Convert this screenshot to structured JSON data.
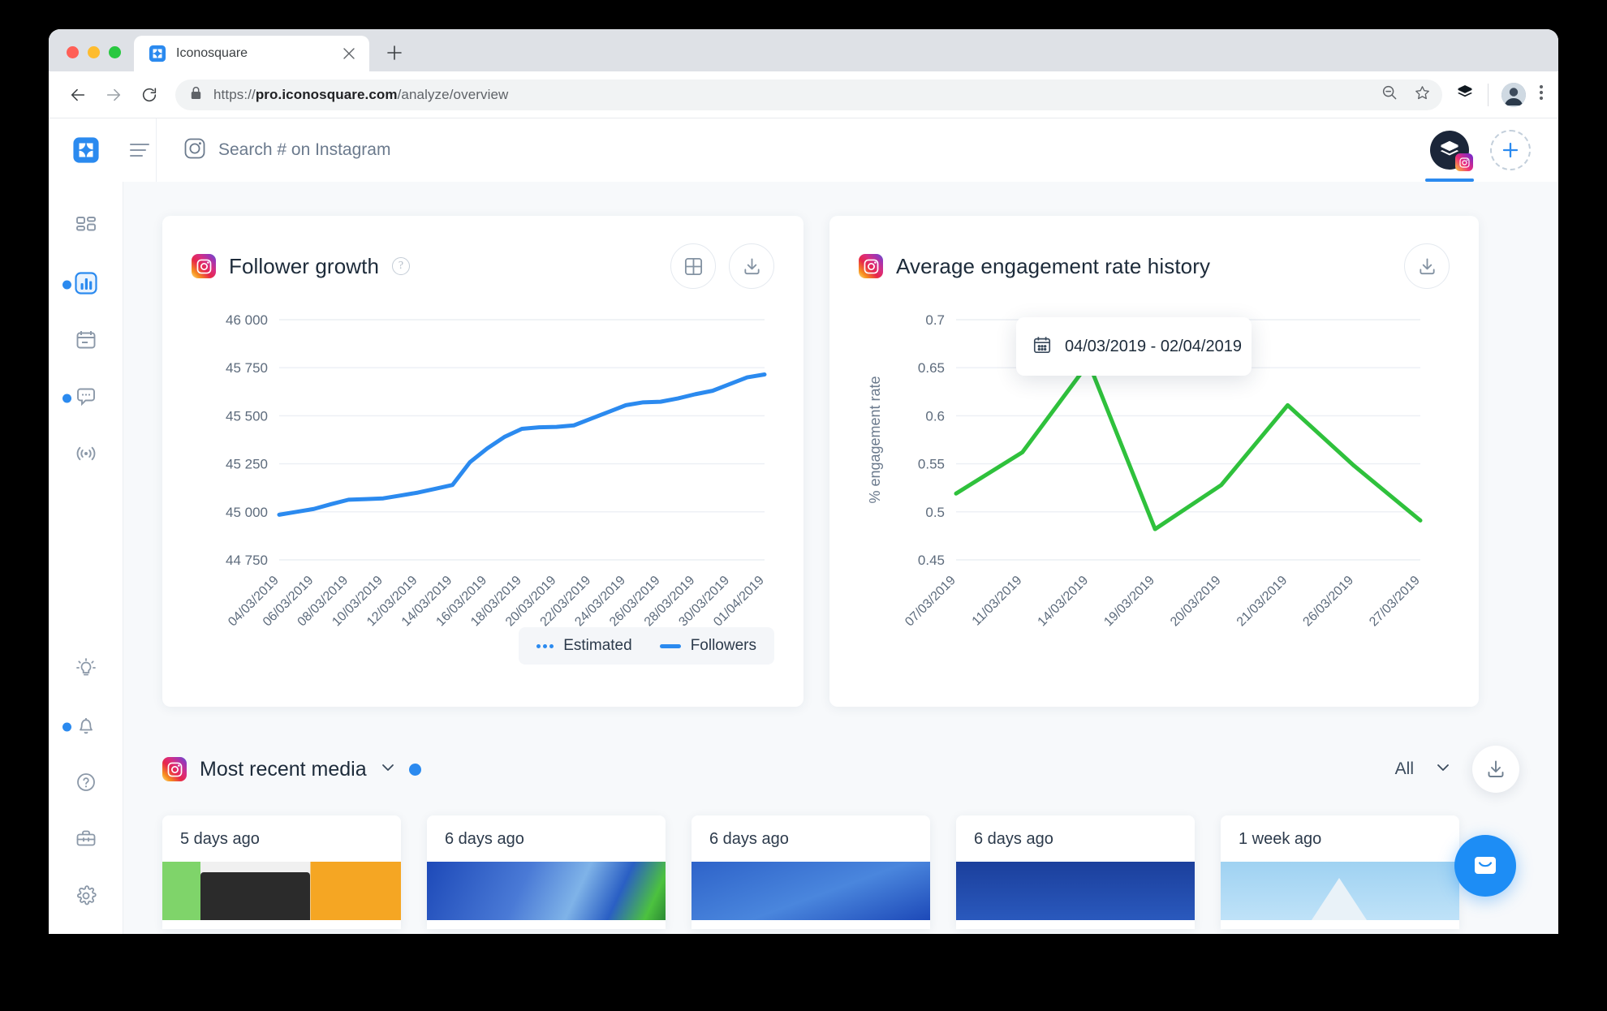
{
  "browser": {
    "tab": {
      "title": "Iconosquare",
      "favicon": "iconosquare-logo-icon",
      "close": "close-icon"
    },
    "newtab_label": "+",
    "url_protocol": "https://",
    "url_host": "pro.iconosquare.com",
    "url_path": "/analyze/overview",
    "back_icon": "back-arrow-icon",
    "forward_icon": "forward-arrow-icon",
    "reload_icon": "reload-icon",
    "lock_icon": "lock-icon",
    "zoom_out_icon": "zoom-out-icon",
    "bookmark_icon": "star-icon",
    "extension_icon": "buffer-extension-icon",
    "profile_icon": "profile-avatar",
    "menu_icon": "kebab-menu-icon"
  },
  "appbar": {
    "logo": "iconosquare-logo-icon",
    "menu_icon": "hamburger-icon",
    "search_icon": "instagram-icon",
    "search_placeholder": "Search # on Instagram",
    "account_icon": "buffer-account-icon",
    "account_network_badge": "instagram-icon",
    "add_account_icon": "plus-icon"
  },
  "sidebar": {
    "items": [
      {
        "name": "dashboard",
        "icon": "grid-dashboard-icon",
        "active": false,
        "dot": false
      },
      {
        "name": "analytics",
        "icon": "bar-chart-icon",
        "active": true,
        "dot": true
      },
      {
        "name": "scheduler",
        "icon": "calendar-icon",
        "active": false,
        "dot": false
      },
      {
        "name": "conversations",
        "icon": "comment-bubble-icon",
        "active": false,
        "dot": true
      },
      {
        "name": "listening",
        "icon": "broadcast-icon",
        "active": false,
        "dot": false
      }
    ],
    "bottom_items": [
      {
        "name": "insights",
        "icon": "lightbulb-icon",
        "active": false,
        "dot": false
      },
      {
        "name": "notifications",
        "icon": "bell-icon",
        "active": false,
        "dot": true
      },
      {
        "name": "help",
        "icon": "question-circle-icon",
        "active": false,
        "dot": false
      },
      {
        "name": "toolbox",
        "icon": "briefcase-icon",
        "active": false,
        "dot": false
      },
      {
        "name": "settings",
        "icon": "gear-icon",
        "active": false,
        "dot": false
      }
    ]
  },
  "follower_card": {
    "network_icon": "instagram-icon",
    "title": "Follower growth",
    "help_icon": "question-mark-icon",
    "table_view_icon": "table-grid-icon",
    "download_icon": "download-icon",
    "legend": [
      {
        "label": "Estimated",
        "style": "dotted",
        "color": "#2b8aef"
      },
      {
        "label": "Followers",
        "style": "solid",
        "color": "#2b8aef"
      }
    ]
  },
  "engagement_card": {
    "network_icon": "instagram-icon",
    "title": "Average engagement rate history",
    "download_icon": "download-icon"
  },
  "datepicker": {
    "calendar_icon": "calendar-icon",
    "value": "04/03/2019 - 02/04/2019",
    "chevron_icon": "chevron-down-icon"
  },
  "media_section": {
    "network_icon": "instagram-icon",
    "title": "Most recent media",
    "chevron_icon": "chevron-down-icon",
    "badge_dot_color": "#2b8aef",
    "filter_label": "All",
    "filter_chevron_icon": "chevron-down-icon",
    "download_icon": "download-icon",
    "cards": [
      {
        "date": "5 days ago",
        "thumb": "t1"
      },
      {
        "date": "6 days ago",
        "thumb": "t2"
      },
      {
        "date": "6 days ago",
        "thumb": "t3"
      },
      {
        "date": "6 days ago",
        "thumb": "t4"
      },
      {
        "date": "1 week ago",
        "thumb": "t5"
      }
    ]
  },
  "intercom": {
    "icon": "chat-launcher-icon",
    "color": "#1d8df5"
  },
  "chart_data": [
    {
      "id": "follower-growth",
      "type": "line",
      "title": "Follower growth",
      "xlabel": "",
      "ylabel": "",
      "ylim": [
        44750,
        46000
      ],
      "yticks": [
        44750,
        45000,
        45250,
        45500,
        45750,
        46000
      ],
      "ytick_labels": [
        "44 750",
        "45 000",
        "45 250",
        "45 500",
        "45 750",
        "46 000"
      ],
      "grid": true,
      "legend_position": "bottom-right",
      "x": [
        "04/03/2019",
        "05/03/2019",
        "06/03/2019",
        "07/03/2019",
        "08/03/2019",
        "09/03/2019",
        "10/03/2019",
        "11/03/2019",
        "12/03/2019",
        "13/03/2019",
        "14/03/2019",
        "15/03/2019",
        "16/03/2019",
        "17/03/2019",
        "18/03/2019",
        "19/03/2019",
        "20/03/2019",
        "21/03/2019",
        "22/03/2019",
        "23/03/2019",
        "24/03/2019",
        "25/03/2019",
        "26/03/2019",
        "27/03/2019",
        "28/03/2019",
        "29/03/2019",
        "30/03/2019",
        "31/03/2019",
        "01/04/2019"
      ],
      "xtick_labels": [
        "04/03/2019",
        "06/03/2019",
        "08/03/2019",
        "10/03/2019",
        "12/03/2019",
        "14/03/2019",
        "16/03/2019",
        "18/03/2019",
        "20/03/2019",
        "22/03/2019",
        "24/03/2019",
        "26/03/2019",
        "28/03/2019",
        "30/03/2019",
        "01/04/2019"
      ],
      "series": [
        {
          "name": "Followers",
          "color": "#2b8aef",
          "values": [
            44985,
            45000,
            45015,
            45040,
            45063,
            45066,
            45070,
            45085,
            45100,
            45120,
            45140,
            45258,
            45330,
            45390,
            45432,
            45440,
            45442,
            45450,
            45485,
            45520,
            45555,
            45570,
            45573,
            45590,
            45612,
            45630,
            45665,
            45700,
            45715
          ]
        }
      ]
    },
    {
      "id": "average-engagement-rate-history",
      "type": "line",
      "title": "Average engagement rate history",
      "xlabel": "",
      "ylabel": "% engagement rate",
      "ylim": [
        0.45,
        0.7
      ],
      "yticks": [
        0.45,
        0.5,
        0.55,
        0.6,
        0.65,
        0.7
      ],
      "ytick_labels": [
        "0.45",
        "0.5",
        "0.55",
        "0.6",
        "0.65",
        "0.7"
      ],
      "grid": true,
      "legend_position": "none",
      "x": [
        "07/03/2019",
        "11/03/2019",
        "14/03/2019",
        "19/03/2019",
        "20/03/2019",
        "21/03/2019",
        "26/03/2019",
        "27/03/2019"
      ],
      "xtick_labels": [
        "07/03/2019",
        "11/03/2019",
        "14/03/2019",
        "19/03/2019",
        "20/03/2019",
        "21/03/2019",
        "26/03/2019",
        "27/03/2019"
      ],
      "series": [
        {
          "name": "% engagement rate",
          "color": "#2fc13c",
          "values": [
            0.519,
            0.562,
            0.655,
            0.482,
            0.528,
            0.611,
            0.548,
            0.491
          ]
        }
      ]
    }
  ]
}
